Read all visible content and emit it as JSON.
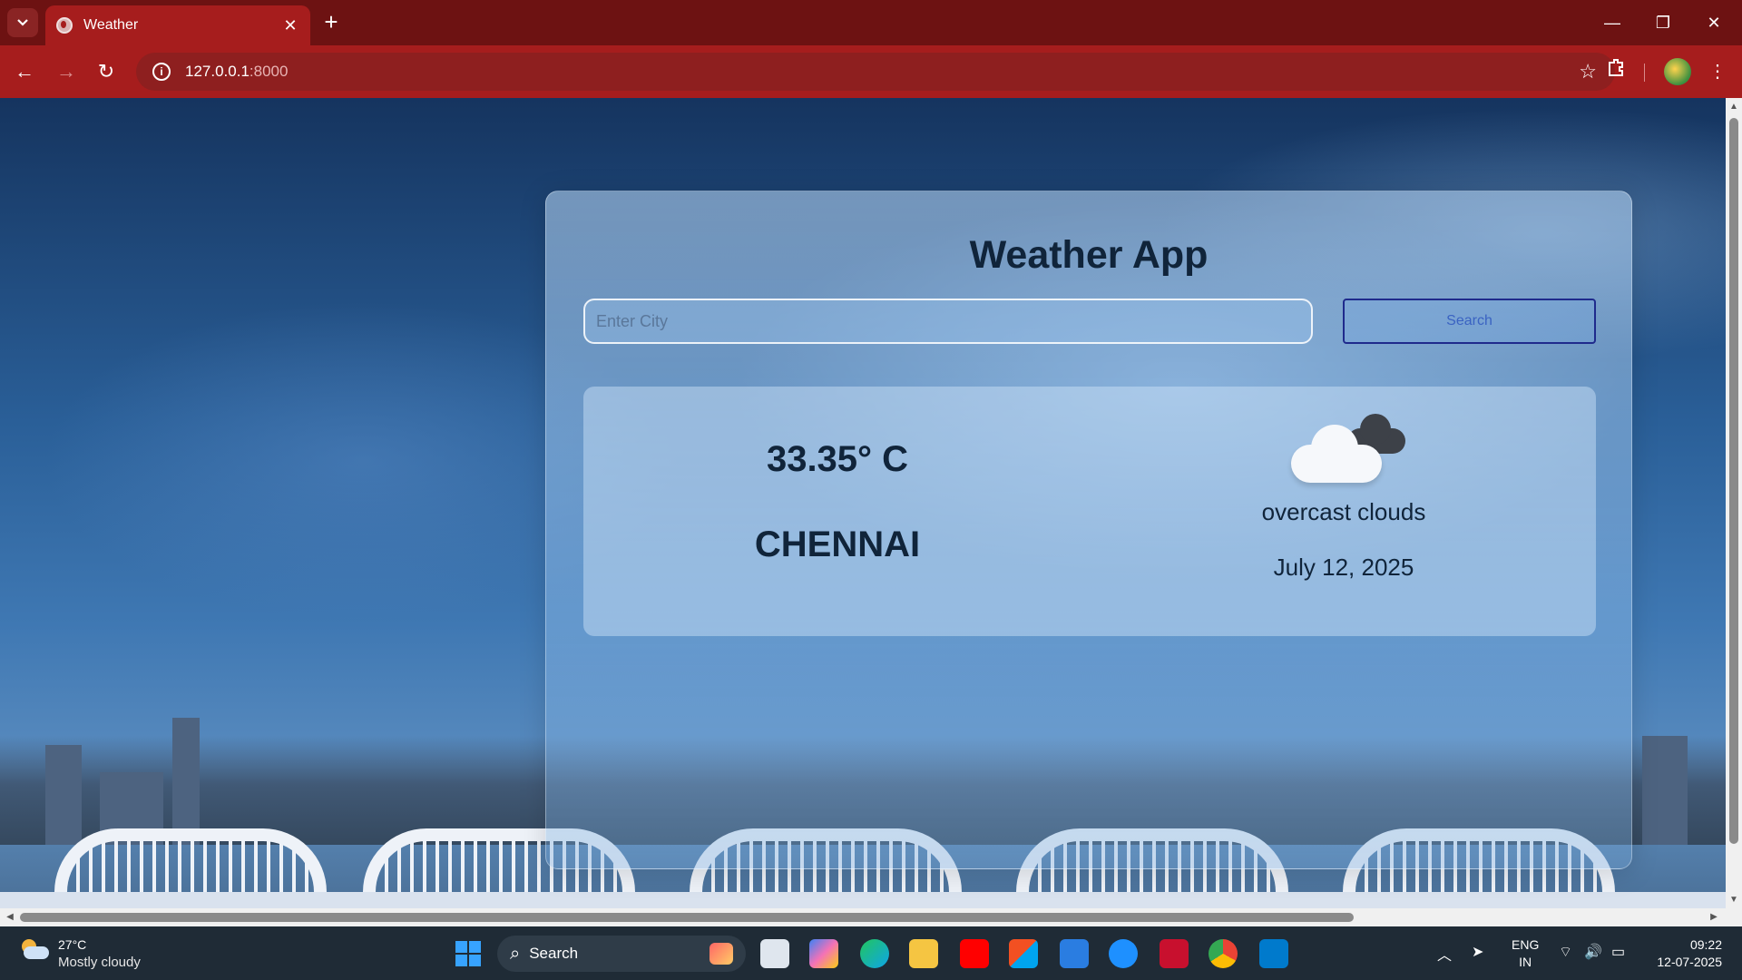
{
  "browser": {
    "tab_title": "Weather",
    "url_host": "127.0.0.1",
    "url_port": ":8000"
  },
  "app": {
    "title": "Weather App",
    "search_placeholder": "Enter City",
    "search_button": "Search"
  },
  "weather": {
    "temperature": "33.35° C",
    "city": "CHENNAI",
    "description": "overcast clouds",
    "date": "July 12, 2025",
    "icon": "overcast-clouds-icon"
  },
  "taskbar": {
    "weather_temp": "27°C",
    "weather_condition": "Mostly cloudy",
    "search_label": "Search",
    "lang_line1": "ENG",
    "lang_line2": "IN",
    "time": "09:22",
    "date": "12-07-2025"
  },
  "colors": {
    "browser_frame": "#a61d1d",
    "tab_strip": "#6d1212",
    "title_text": "#10243a",
    "search_border": "#1f2a8c"
  }
}
